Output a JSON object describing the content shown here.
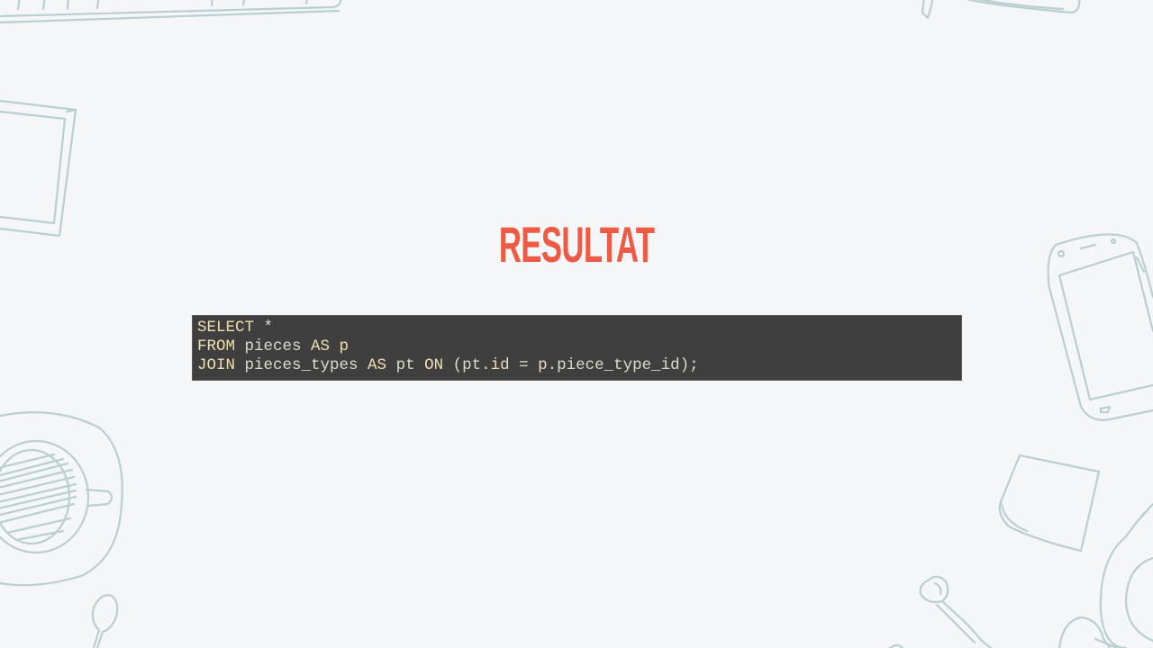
{
  "slide": {
    "title": "RESULTAT"
  },
  "code": {
    "line1": {
      "kw": "SELECT",
      "rest": " *"
    },
    "line2": {
      "kw": "FROM",
      "t1": " pieces ",
      "kw2": "AS",
      "t2": " p"
    },
    "line3": {
      "kw": "JOIN",
      "t1": " pieces_types ",
      "kw2": "AS",
      "t2": " pt ",
      "kw3": "ON",
      "t3": " (pt.",
      "f1": "id",
      "t4": " = ",
      "f2": "p",
      "t5": ".piece_type_id);"
    }
  },
  "colors": {
    "title": "#f05a45",
    "code_background": "#3f3f3f",
    "keyword": "#f0dfaf",
    "text": "#dcdccc",
    "sketch": "#b9cfd0",
    "page_background": "#f4f6f8"
  }
}
